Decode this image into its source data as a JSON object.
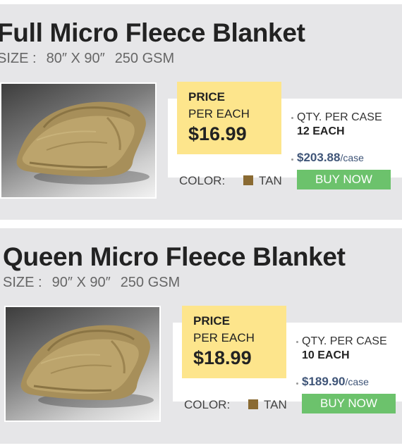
{
  "accent": {
    "price_box": "#fde58c",
    "buy_button": "#6cc26c",
    "swatch_tan": "#8a6a32",
    "case_price": "#3f5578"
  },
  "products": [
    {
      "title": "Full Micro Fleece Blanket",
      "size_label": "SIZE :",
      "size_dims": "80″ X 90″",
      "size_gsm": "250 GSM",
      "image_icon": "folded-blanket-photo",
      "price_l1": "PRICE",
      "price_l2": "PER EACH",
      "price": "$16.99",
      "qty_label": "QTY. PER CASE",
      "qty_value": "12 EACH",
      "case_price": "$203.88",
      "case_unit": "/case",
      "color_label": "COLOR:",
      "color_name": "TAN",
      "buy_label": "BUY NOW"
    },
    {
      "title": "Queen Micro Fleece Blanket",
      "size_label": "SIZE :",
      "size_dims": "90″ X 90″",
      "size_gsm": "250 GSM",
      "image_icon": "folded-blanket-photo",
      "price_l1": "PRICE",
      "price_l2": "PER EACH",
      "price": "$18.99",
      "qty_label": "QTY. PER CASE",
      "qty_value": "10 EACH",
      "case_price": "$189.90",
      "case_unit": "/case",
      "color_label": "COLOR:",
      "color_name": "TAN",
      "buy_label": "BUY NOW"
    }
  ]
}
